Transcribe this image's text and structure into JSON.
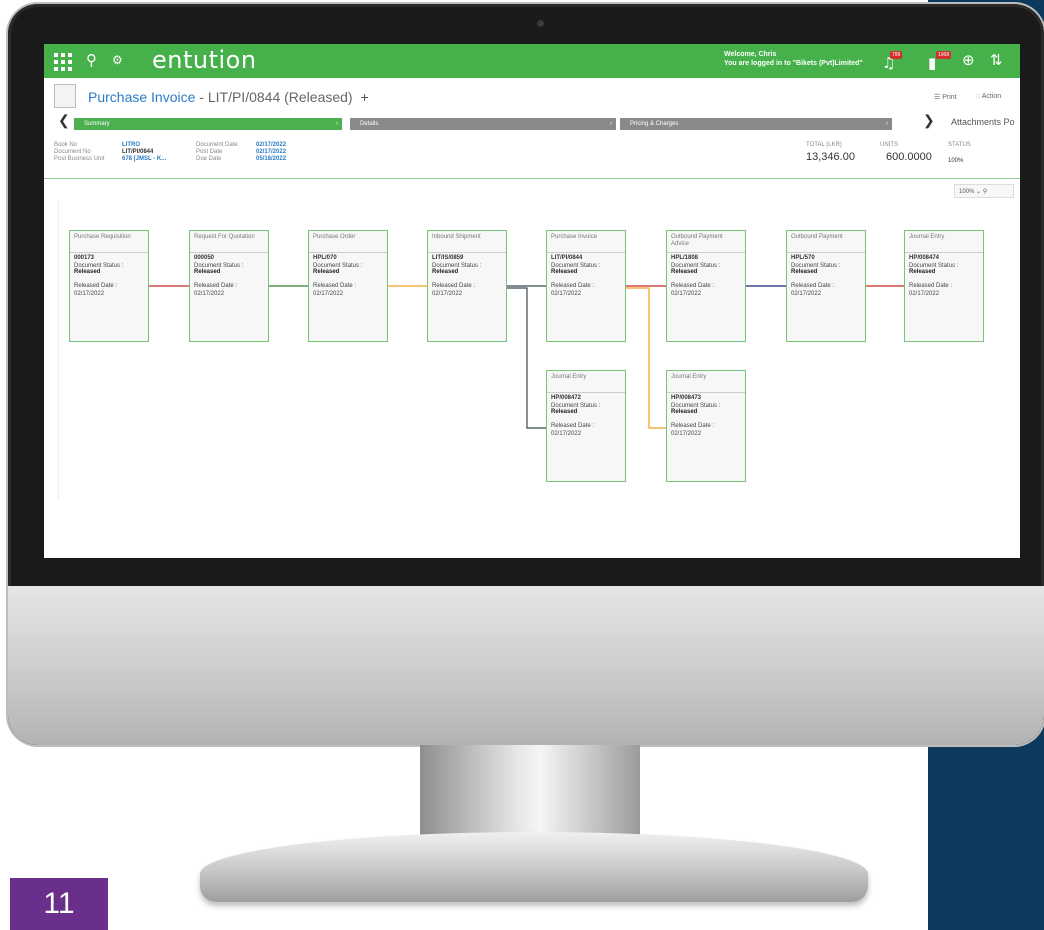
{
  "app": {
    "logo": "entution",
    "welcome_line1": "Welcome, Chris",
    "welcome_line2": "You are logged in to \"Bikets (Pvt)Limited\"",
    "notif_count": "799",
    "doc_count": "1068"
  },
  "header": {
    "title": "Purchase Invoice",
    "doc_ref": " - LIT/PI/0844  (Released)",
    "add": "+",
    "print": "Print",
    "action": "Action"
  },
  "steps": [
    {
      "label": "Summary",
      "color": "#4caf50"
    },
    {
      "label": "Details",
      "color": "#8a8a8a"
    },
    {
      "label": "Pricing & Charges",
      "color": "#8a8a8a"
    }
  ],
  "attachments": "Attachments  Po",
  "info": {
    "book_no_label": "Book No",
    "book_no": "LITRO",
    "doc_no_label": "Document No",
    "doc_no": "LIT/PI/0844",
    "bu_label": "Post Business Unit",
    "bu": "678 [JMSL - K...",
    "doc_date_label": "Document Date",
    "doc_date": "02/17/2022",
    "post_date_label": "Post Date",
    "post_date": "02/17/2022",
    "due_date_label": "Due Date",
    "due_date": "05/18/2022",
    "total_label": "TOTAL (LKR)",
    "total": "13,346.00",
    "units_label": "UNITS",
    "units": "600.0000",
    "status_label": "STATUS",
    "status": "100%"
  },
  "zoom": "100%",
  "nodes": [
    {
      "title": "Purchase Requisition",
      "no": "000173",
      "status_label": "Document Status :",
      "status": "Released",
      "rel_label": "Released Date :",
      "rel_date": "02/17/2022"
    },
    {
      "title": "Request For Quotation",
      "no": "000050",
      "status_label": "Document Status :",
      "status": "Released",
      "rel_label": "Released Date :",
      "rel_date": "02/17/2022"
    },
    {
      "title": "Purchase Order",
      "no": "HPL/070",
      "status_label": "Document Status :",
      "status": "Released",
      "rel_label": "Released Date :",
      "rel_date": "02/17/2022"
    },
    {
      "title": "Inbound Shipment",
      "no": "LIT/IS/0859",
      "status_label": "Document Status :",
      "status": "Released",
      "rel_label": "Released Date :",
      "rel_date": "02/17/2022"
    },
    {
      "title": "Purchase Invoice",
      "no": "LIT/PI/0844",
      "status_label": "Document Status :",
      "status": "Released",
      "rel_label": "Released Date :",
      "rel_date": "02/17/2022"
    },
    {
      "title": "Outbound Payment Advice",
      "no": "HPL/1808",
      "status_label": "Document Status :",
      "status": "Released",
      "rel_label": "Released Date :",
      "rel_date": "02/17/2022"
    },
    {
      "title": "Outbound Payment",
      "no": "HPL/570",
      "status_label": "Document Status :",
      "status": "Released",
      "rel_label": "Released Date :",
      "rel_date": "02/17/2022"
    },
    {
      "title": "Journal Entry",
      "no": "HP/008474",
      "status_label": "Document Status :",
      "status": "Released",
      "rel_label": "Released Date :",
      "rel_date": "02/17/2022"
    },
    {
      "title": "Journal Entry",
      "no": "HP/008472",
      "status_label": "Document Status :",
      "status": "Released",
      "rel_label": "Released Date :",
      "rel_date": "02/17/2022"
    },
    {
      "title": "Journal Entry",
      "no": "HP/008473",
      "status_label": "Document Status :",
      "status": "Released",
      "rel_label": "Released Date :",
      "rel_date": "02/17/2022"
    }
  ],
  "link_colors": {
    "red": "#c62828",
    "green": "#2e7d32",
    "amber": "#f0a020",
    "dark": "#37474f",
    "navy": "#1a237e"
  },
  "colors": {
    "brand_green": "#46b04a",
    "side_band": "#0d3a5c",
    "page_tag": "#6a2f8a"
  },
  "page_number": "11"
}
